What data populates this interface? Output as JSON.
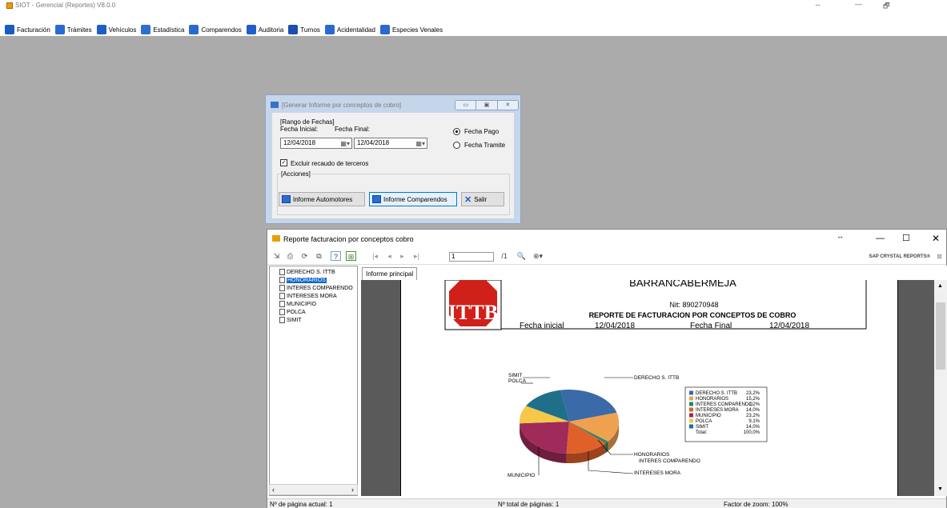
{
  "app": {
    "title": "SIOT - Gerencial (Reportes) V8.0.0",
    "resize_glyph": "↔",
    "minimize_glyph": "—",
    "restore_glyph": "🗗"
  },
  "menu": [
    {
      "label": "Facturación",
      "icon": "dollar-icon",
      "color": "#1a5bbf"
    },
    {
      "label": "Trámites",
      "icon": "clipboard-check-icon",
      "color": "#2a6ad0"
    },
    {
      "label": "Vehículos",
      "icon": "truck-icon",
      "color": "#1f5ec7"
    },
    {
      "label": "Estadística",
      "icon": "chart-doc-icon",
      "color": "#2e6fd3"
    },
    {
      "label": "Comparendos",
      "icon": "ticket-icon",
      "color": "#2a6ad0"
    },
    {
      "label": "Auditoria",
      "icon": "audit-icon",
      "color": "#1f5ec7"
    },
    {
      "label": "Turnos",
      "icon": "tag-icon",
      "color": "#1a4fb0"
    },
    {
      "label": "Acidentalidad",
      "icon": "buildings-icon",
      "color": "#2a6ad0"
    },
    {
      "label": "Especies Venales",
      "icon": "stamp-icon",
      "color": "#2a6ad0"
    }
  ],
  "dialog": {
    "title": "[Generar Informe por conceptos de cobro]",
    "range_group": "[Rango de Fechas]",
    "start_label": "Fecha Inicial:",
    "start_value": "12/04/2018",
    "end_label": "Fecha Final:",
    "end_value": "12/04/2018",
    "radio_pago": "Fecha Pago",
    "radio_tramite": "Fecha Tramite",
    "exclude_label": "Excluir recaudo de terceros",
    "actions_group": "[Acciones]",
    "btn_automotores": "Informe Automotores",
    "btn_comparendos": "Informe Comparendos",
    "btn_salir": "Salir"
  },
  "report": {
    "title": "Reporte facturacion por conceptos cobro",
    "page_value": "1",
    "page_total": "/1",
    "brand": "SAP CRYSTAL REPORTS®",
    "tab": "Informe principal",
    "tree": [
      "DERECHO S. ITTB",
      "HONORARIOS",
      "INTERES COMPARENDO",
      "INTERESES MORA",
      "MUNICIPIO",
      "POLCA",
      "SIMIT"
    ],
    "header": {
      "city": "BARRANCABERMEJA",
      "nit": "Nit: 890270948",
      "heading": "REPORTE DE FACTURACION POR CONCEPTOS DE COBRO",
      "start_label": "Fecha inicial",
      "start_value": "12/04/2018",
      "end_label": "Fecha Final",
      "end_value": "12/04/2018",
      "logo_text": "ITTB"
    },
    "status": {
      "current": "Nº de página actual: 1",
      "total": "Nº total de páginas: 1",
      "zoom": "Factor de zoom: 100%"
    }
  },
  "chart_data": {
    "type": "pie",
    "categories": [
      "DERECHO S. ITTB",
      "HONORARIOS",
      "INTERES COMPARENDO",
      "INTERESES MORA",
      "MUNICIPIO",
      "POLCA",
      "SIMIT"
    ],
    "values": [
      23.2,
      15.2,
      1.2,
      14.0,
      23.2,
      9.1,
      14.0
    ],
    "value_labels": [
      "23,2%",
      "15,2%",
      "1,2%",
      "14,0%",
      "23,2%",
      "9,1%",
      "14,0%"
    ],
    "total_label": "Total:",
    "total_value": "100,0%",
    "slice_labels": [
      "DERECHO S. ITTB",
      "HONORARIOS",
      "INTERES COMPARENDO",
      "INTERESES MORA",
      "MUNICIPIO",
      "POLCA",
      "SIMIT"
    ],
    "colors": [
      "#3b6aa8",
      "#f0a150",
      "#1e8a6a",
      "#e0602a",
      "#a02a5a",
      "#f5c84a",
      "#1f6f8a"
    ],
    "legend": "right"
  }
}
